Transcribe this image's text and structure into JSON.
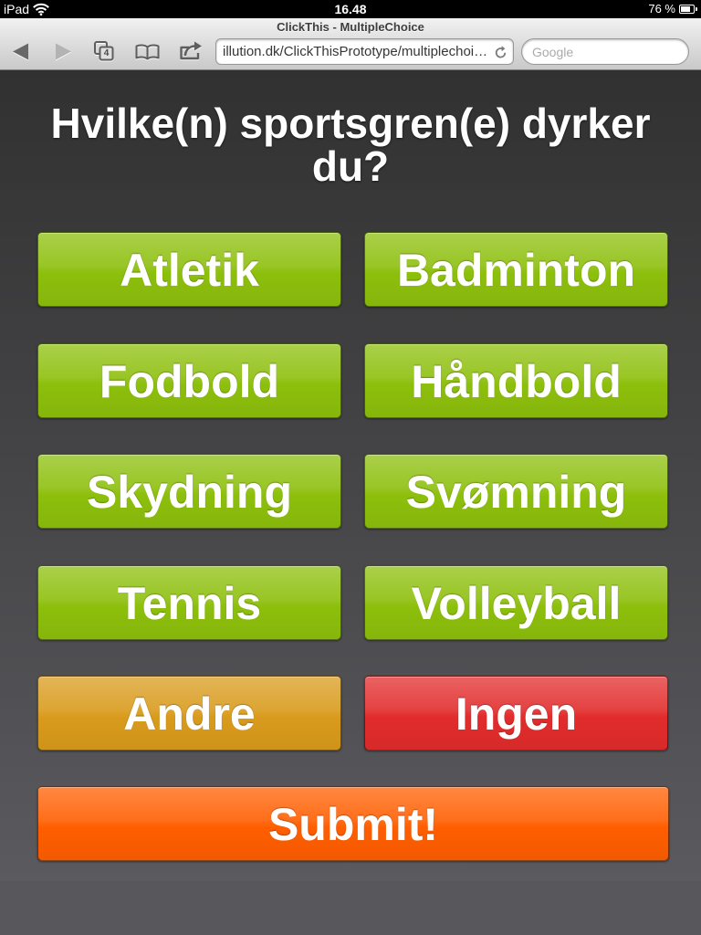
{
  "status_bar": {
    "device_label": "iPad",
    "time": "16.48",
    "battery_text": "76 %",
    "battery_level": 0.76,
    "icons": [
      "wifi-icon",
      "battery-icon"
    ]
  },
  "browser": {
    "page_title": "ClickThis - MultipleChoice",
    "tab_count": "4",
    "url": "illution.dk/ClickThisPrototype/multiplechoi…",
    "search_placeholder": "Google",
    "toolbar_icons": [
      "back-arrow-icon",
      "forward-arrow-icon",
      "tabs-icon",
      "bookmarks-icon",
      "share-icon",
      "reload-icon"
    ]
  },
  "question": "Hvilke(n) sportsgren(e) dyrker du?",
  "options": [
    {
      "label": "Atletik",
      "color": "#8dbf0c"
    },
    {
      "label": "Badminton",
      "color": "#8dbf0c"
    },
    {
      "label": "Fodbold",
      "color": "#8dbf0c"
    },
    {
      "label": "Håndbold",
      "color": "#8dbf0c"
    },
    {
      "label": "Skydning",
      "color": "#8dbf0c"
    },
    {
      "label": "Svømning",
      "color": "#8dbf0c"
    },
    {
      "label": "Tennis",
      "color": "#8dbf0c"
    },
    {
      "label": "Volleyball",
      "color": "#8dbf0c"
    },
    {
      "label": "Andre",
      "color": "#d99b1c"
    },
    {
      "label": "Ingen",
      "color": "#e22c2c"
    }
  ],
  "submit": {
    "label": "Submit!",
    "color": "#ff5e00"
  }
}
